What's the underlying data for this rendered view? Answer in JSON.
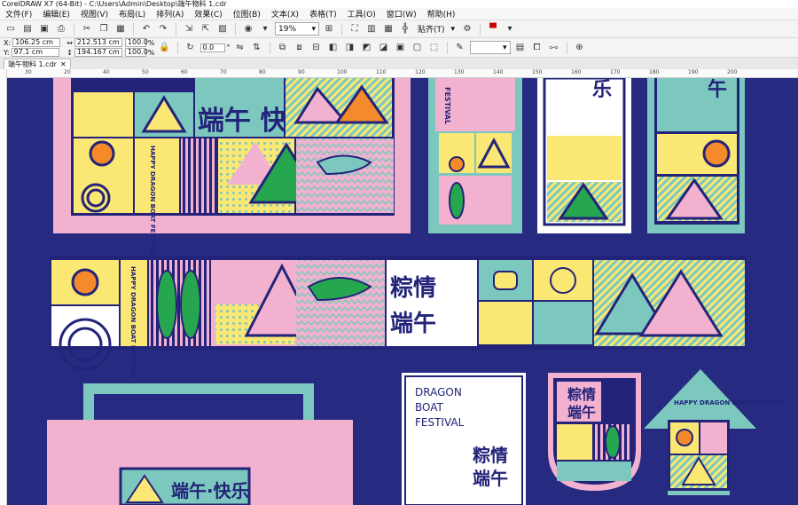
{
  "window": {
    "title": "CorelDRAW X7 (64-Bit) - C:\\Users\\Admin\\Desktop\\端午物料 1.cdr"
  },
  "menu": [
    "文件(F)",
    "编辑(E)",
    "视图(V)",
    "布局(L)",
    "排列(A)",
    "效果(C)",
    "位图(B)",
    "文本(X)",
    "表格(T)",
    "工具(O)",
    "窗口(W)",
    "帮助(H)"
  ],
  "toolbar": {
    "zoom": "19%",
    "snap_label": "贴齐(T)"
  },
  "propbar": {
    "x_label": "X:",
    "x": "106.25 cm",
    "y_label": "Y:",
    "y": "97.1 cm",
    "w": "212.513 cm",
    "h": "194.167 cm",
    "sx": "100.0",
    "sy": "100.0",
    "pct": "%",
    "angle": "0.0",
    "deg": "°"
  },
  "tab": {
    "label": "端午物料 1.cdr"
  },
  "ruler_marks": [
    "30",
    "20",
    "40",
    "50",
    "60",
    "70",
    "80",
    "90",
    "100",
    "110",
    "120",
    "130",
    "140",
    "150",
    "160",
    "170",
    "180",
    "190",
    "200"
  ],
  "artwork": {
    "banner_title": "端午 快乐",
    "festival_vertical": "HAPPY DRAGON BOAT FESTIVAL",
    "title_zongqing": "粽情",
    "title_duanwu": "端午",
    "poster_line1": "DRAGON",
    "poster_line2": "BOAT",
    "poster_line3": "FESTIVAL",
    "bag_title": "端午·快乐",
    "arrow_title": "HAPPY DRAGON BOAT FESTIVAL",
    "vertical_festival": "FESTIVAL",
    "char_wu": "午",
    "char_le": "乐"
  },
  "colors": {
    "canvas": "#262a80",
    "pink": "#f2b2cf",
    "teal": "#7cc8be",
    "yellow": "#fbe773",
    "navy": "#23237a",
    "green": "#27a650",
    "orange": "#f48a2a"
  }
}
